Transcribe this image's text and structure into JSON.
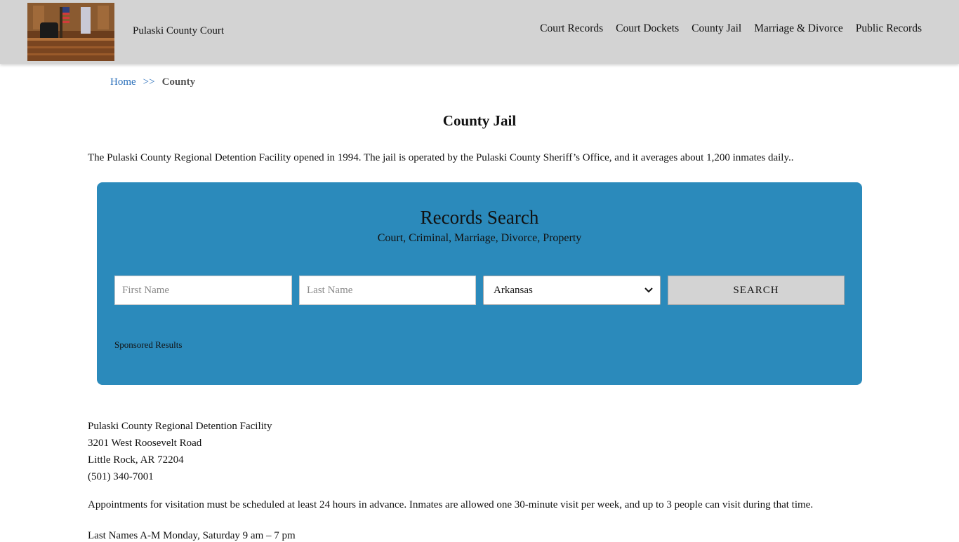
{
  "header": {
    "site_title": "Pulaski County Court",
    "logo_icon": "courtroom-photo-icon",
    "nav": [
      {
        "label": "Court Records"
      },
      {
        "label": "Court Dockets"
      },
      {
        "label": "County Jail"
      },
      {
        "label": "Marriage & Divorce"
      },
      {
        "label": "Public Records"
      }
    ]
  },
  "breadcrumb": {
    "home": "Home",
    "separator": ">>",
    "current": "County"
  },
  "page": {
    "title": "County Jail",
    "intro": "The Pulaski County Regional Detention Facility opened in 1994. The jail is operated by the Pulaski County Sheriff’s Office, and it averages about 1,200 inmates daily.."
  },
  "search": {
    "title": "Records Search",
    "subtitle": "Court, Criminal, Marriage, Divorce, Property",
    "first_name_placeholder": "First Name",
    "last_name_placeholder": "Last Name",
    "state_selected": "Arkansas",
    "button_label": "SEARCH",
    "sponsored": "Sponsored Results",
    "panel_color": "#2b8abb"
  },
  "address": {
    "name": "Pulaski County Regional Detention Facility",
    "street": "3201 West Roosevelt Road",
    "city": "Little Rock, AR 72204",
    "phone": "(501) 340-7001"
  },
  "visitation": {
    "text": "Appointments for visitation must be scheduled at least 24 hours in advance. Inmates are allowed one 30-minute visit per week, and up to 3 people can visit during that time.",
    "hours": "Last Names A-M Monday, Saturday 9 am – 7 pm"
  }
}
